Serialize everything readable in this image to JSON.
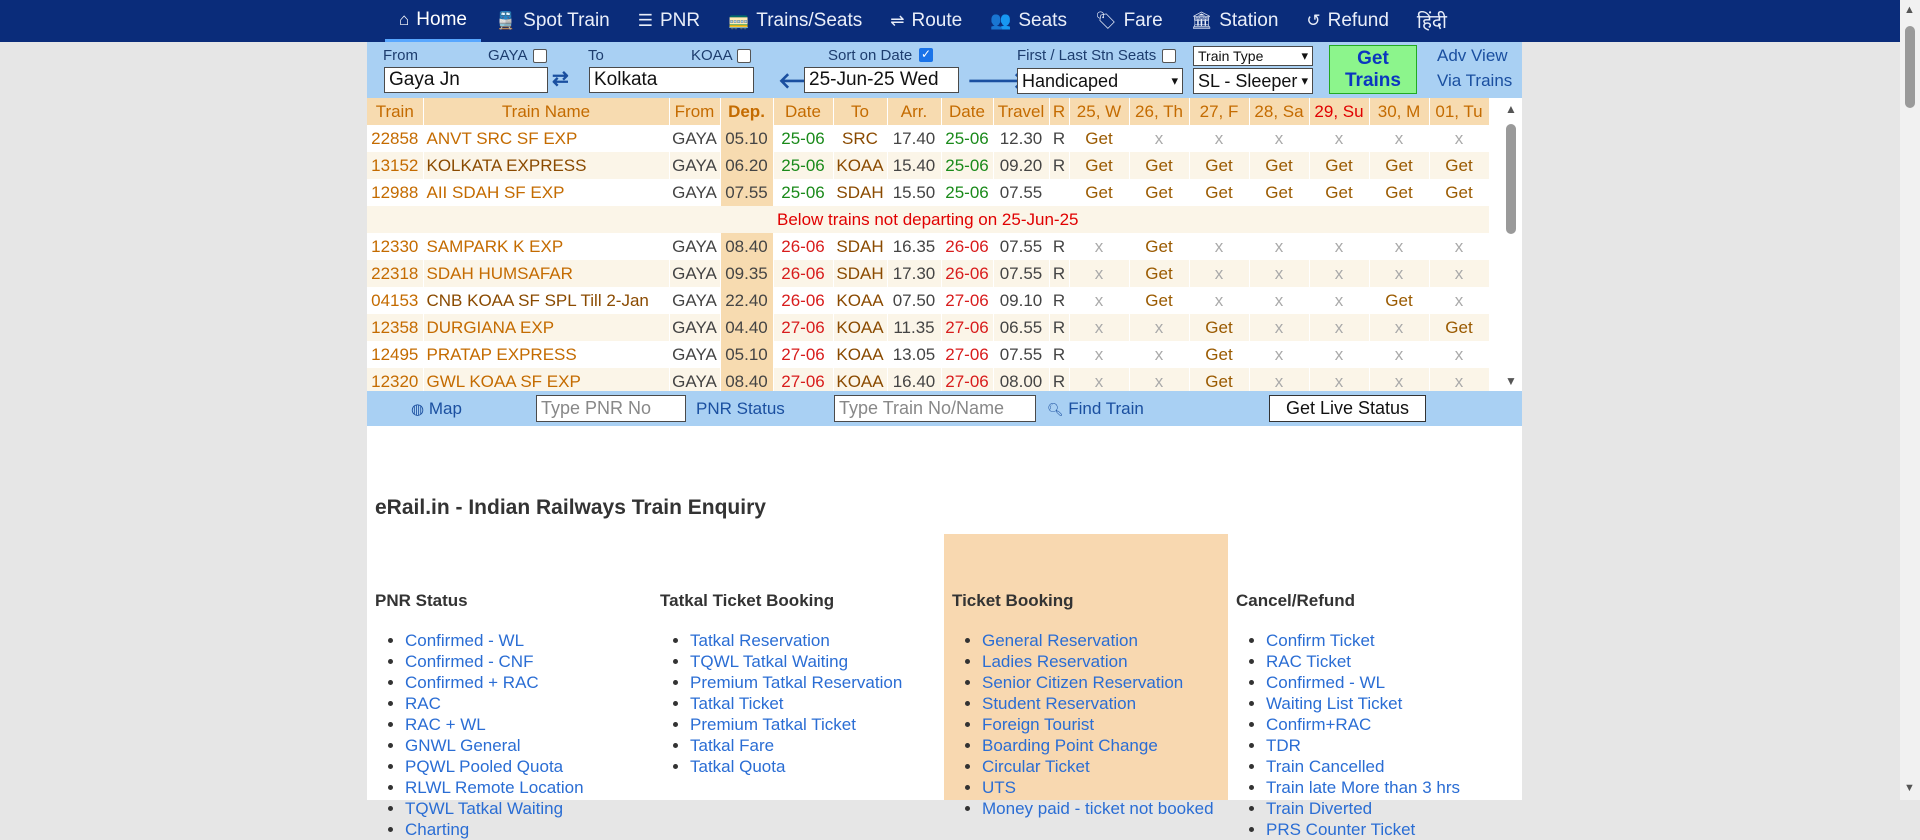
{
  "nav": {
    "items": [
      {
        "icon": "home-icon",
        "glyph": "⌂",
        "label": "Home",
        "active": true
      },
      {
        "icon": "train-icon",
        "glyph": "🚆",
        "label": "Spot Train"
      },
      {
        "icon": "list-icon",
        "glyph": "☰",
        "label": "PNR"
      },
      {
        "icon": "seats-icon",
        "glyph": "🚃",
        "label": "Trains/Seats"
      },
      {
        "icon": "signpost-icon",
        "glyph": "⇌",
        "label": "Route"
      },
      {
        "icon": "people-icon",
        "glyph": "👥",
        "label": "Seats"
      },
      {
        "icon": "ticket-icon",
        "glyph": "🏷",
        "label": "Fare"
      },
      {
        "icon": "station-icon",
        "glyph": "🏛",
        "label": "Station"
      },
      {
        "icon": "undo-icon",
        "glyph": "↺",
        "label": "Refund"
      },
      {
        "icon": "",
        "glyph": "",
        "label": "हिंदी"
      }
    ]
  },
  "search": {
    "from_label": "From",
    "from_code": "GAYA",
    "from_value": "Gaya Jn",
    "to_label": "To",
    "to_code": "KOAA",
    "to_value": "Kolkata",
    "sort_label": "Sort on Date",
    "date_value": "25-Jun-25 Wed",
    "first_last_label": "First / Last Stn Seats",
    "quota_value": "Handicaped",
    "train_type_label": "Train Type",
    "class_value": "SL - Sleeper",
    "get_trains": "Get Trains",
    "adv_view": "Adv View",
    "via_trains": "Via Trains"
  },
  "table": {
    "headers": [
      "Train",
      "Train Name",
      "From",
      "Dep.",
      "Date",
      "To",
      "Arr.",
      "Date",
      "Travel",
      "R",
      "25, W",
      "26, Th",
      "27, F",
      "28, Sa",
      "29, Su",
      "30, M",
      "01, Tu"
    ],
    "notice": "Below trains not departing on 25-Jun-25",
    "rows_before": [
      {
        "no": "22858",
        "name": "ANVT SRC SF EXP",
        "from": "GAYA",
        "dep": "05.10",
        "ddate": "25-06",
        "to": "SRC",
        "arr": "17.40",
        "adate": "25-06",
        "travel": "12.30",
        "r": "R",
        "days": [
          "Get",
          "x",
          "x",
          "x",
          "x",
          "x",
          "x"
        ]
      },
      {
        "no": "13152",
        "name": "KOLKATA EXPRESS",
        "from": "GAYA",
        "dep": "06.20",
        "ddate": "25-06",
        "to": "KOAA",
        "arr": "15.40",
        "adate": "25-06",
        "travel": "09.20",
        "r": "R",
        "days": [
          "Get",
          "Get",
          "Get",
          "Get",
          "Get",
          "Get",
          "Get"
        ]
      },
      {
        "no": "12988",
        "name": "AII SDAH SF EXP",
        "from": "GAYA",
        "dep": "07.55",
        "ddate": "25-06",
        "to": "SDAH",
        "arr": "15.50",
        "adate": "25-06",
        "travel": "07.55",
        "r": "",
        "days": [
          "Get",
          "Get",
          "Get",
          "Get",
          "Get",
          "Get",
          "Get"
        ]
      }
    ],
    "rows_after": [
      {
        "no": "12330",
        "name": "SAMPARK K EXP",
        "from": "GAYA",
        "dep": "08.40",
        "ddate": "26-06",
        "to": "SDAH",
        "arr": "16.35",
        "adate": "26-06",
        "travel": "07.55",
        "r": "R",
        "days": [
          "x",
          "Get",
          "x",
          "x",
          "x",
          "x",
          "x"
        ]
      },
      {
        "no": "22318",
        "name": "SDAH HUMSAFAR",
        "from": "GAYA",
        "dep": "09.35",
        "ddate": "26-06",
        "to": "SDAH",
        "arr": "17.30",
        "adate": "26-06",
        "travel": "07.55",
        "r": "R",
        "days": [
          "x",
          "Get",
          "x",
          "x",
          "x",
          "x",
          "x"
        ]
      },
      {
        "no": "04153",
        "name": "CNB KOAA SF SPL",
        "note": "Till 2-Jan",
        "from": "GAYA",
        "dep": "22.40",
        "ddate": "26-06",
        "to": "KOAA",
        "arr": "07.50",
        "adate": "27-06",
        "travel": "09.10",
        "r": "R",
        "days": [
          "x",
          "Get",
          "x",
          "x",
          "x",
          "Get",
          "x"
        ]
      },
      {
        "no": "12358",
        "name": "DURGIANA EXP",
        "from": "GAYA",
        "dep": "04.40",
        "ddate": "27-06",
        "to": "KOAA",
        "arr": "11.35",
        "adate": "27-06",
        "travel": "06.55",
        "r": "R",
        "days": [
          "x",
          "x",
          "Get",
          "x",
          "x",
          "x",
          "Get"
        ]
      },
      {
        "no": "12495",
        "name": "PRATAP EXPRESS",
        "from": "GAYA",
        "dep": "05.10",
        "ddate": "27-06",
        "to": "KOAA",
        "arr": "13.05",
        "adate": "27-06",
        "travel": "07.55",
        "r": "R",
        "days": [
          "x",
          "x",
          "Get",
          "x",
          "x",
          "x",
          "x"
        ]
      },
      {
        "no": "12320",
        "name": "GWL KOAA SF EXP",
        "from": "GAYA",
        "dep": "08.40",
        "ddate": "27-06",
        "to": "KOAA",
        "arr": "16.40",
        "adate": "27-06",
        "travel": "08.00",
        "r": "R",
        "days": [
          "x",
          "x",
          "Get",
          "x",
          "x",
          "x",
          "x"
        ]
      }
    ]
  },
  "bottom": {
    "map": "Map",
    "pnr_placeholder": "Type PNR No",
    "pnr_status": "PNR Status",
    "train_placeholder": "Type Train No/Name",
    "find_train": "Find Train",
    "live_status": "Get Live Status"
  },
  "content": {
    "title": "eRail.in - Indian Railways Train Enquiry",
    "columns": [
      {
        "heading": "PNR Status",
        "links": [
          "Confirmed - WL",
          "Confirmed - CNF",
          "Confirmed + RAC",
          "RAC",
          "RAC + WL",
          "GNWL General",
          "PQWL Pooled Quota",
          "RLWL Remote Location",
          "TQWL Tatkal Waiting",
          "Charting"
        ]
      },
      {
        "heading": "Tatkal Ticket Booking",
        "links": [
          "Tatkal Reservation",
          "TQWL Tatkal Waiting",
          "Premium Tatkal Reservation",
          "Tatkal Ticket",
          "Premium Tatkal Ticket",
          "Tatkal Fare",
          "Tatkal Quota"
        ]
      },
      {
        "heading": "Ticket Booking",
        "links": [
          "General Reservation",
          "Ladies Reservation",
          "Senior Citizen Reservation",
          "Student Reservation",
          "Foreign Tourist",
          "Boarding Point Change",
          "Circular Ticket",
          "UTS",
          "Money paid - ticket not booked"
        ]
      },
      {
        "heading": "Cancel/Refund",
        "links": [
          "Confirm Ticket",
          "RAC Ticket",
          "Confirmed - WL",
          "Waiting List Ticket",
          "Confirm+RAC",
          "TDR",
          "Train Cancelled",
          "Train late More than 3 hrs",
          "Train Diverted",
          "PRS Counter Ticket"
        ]
      }
    ]
  }
}
